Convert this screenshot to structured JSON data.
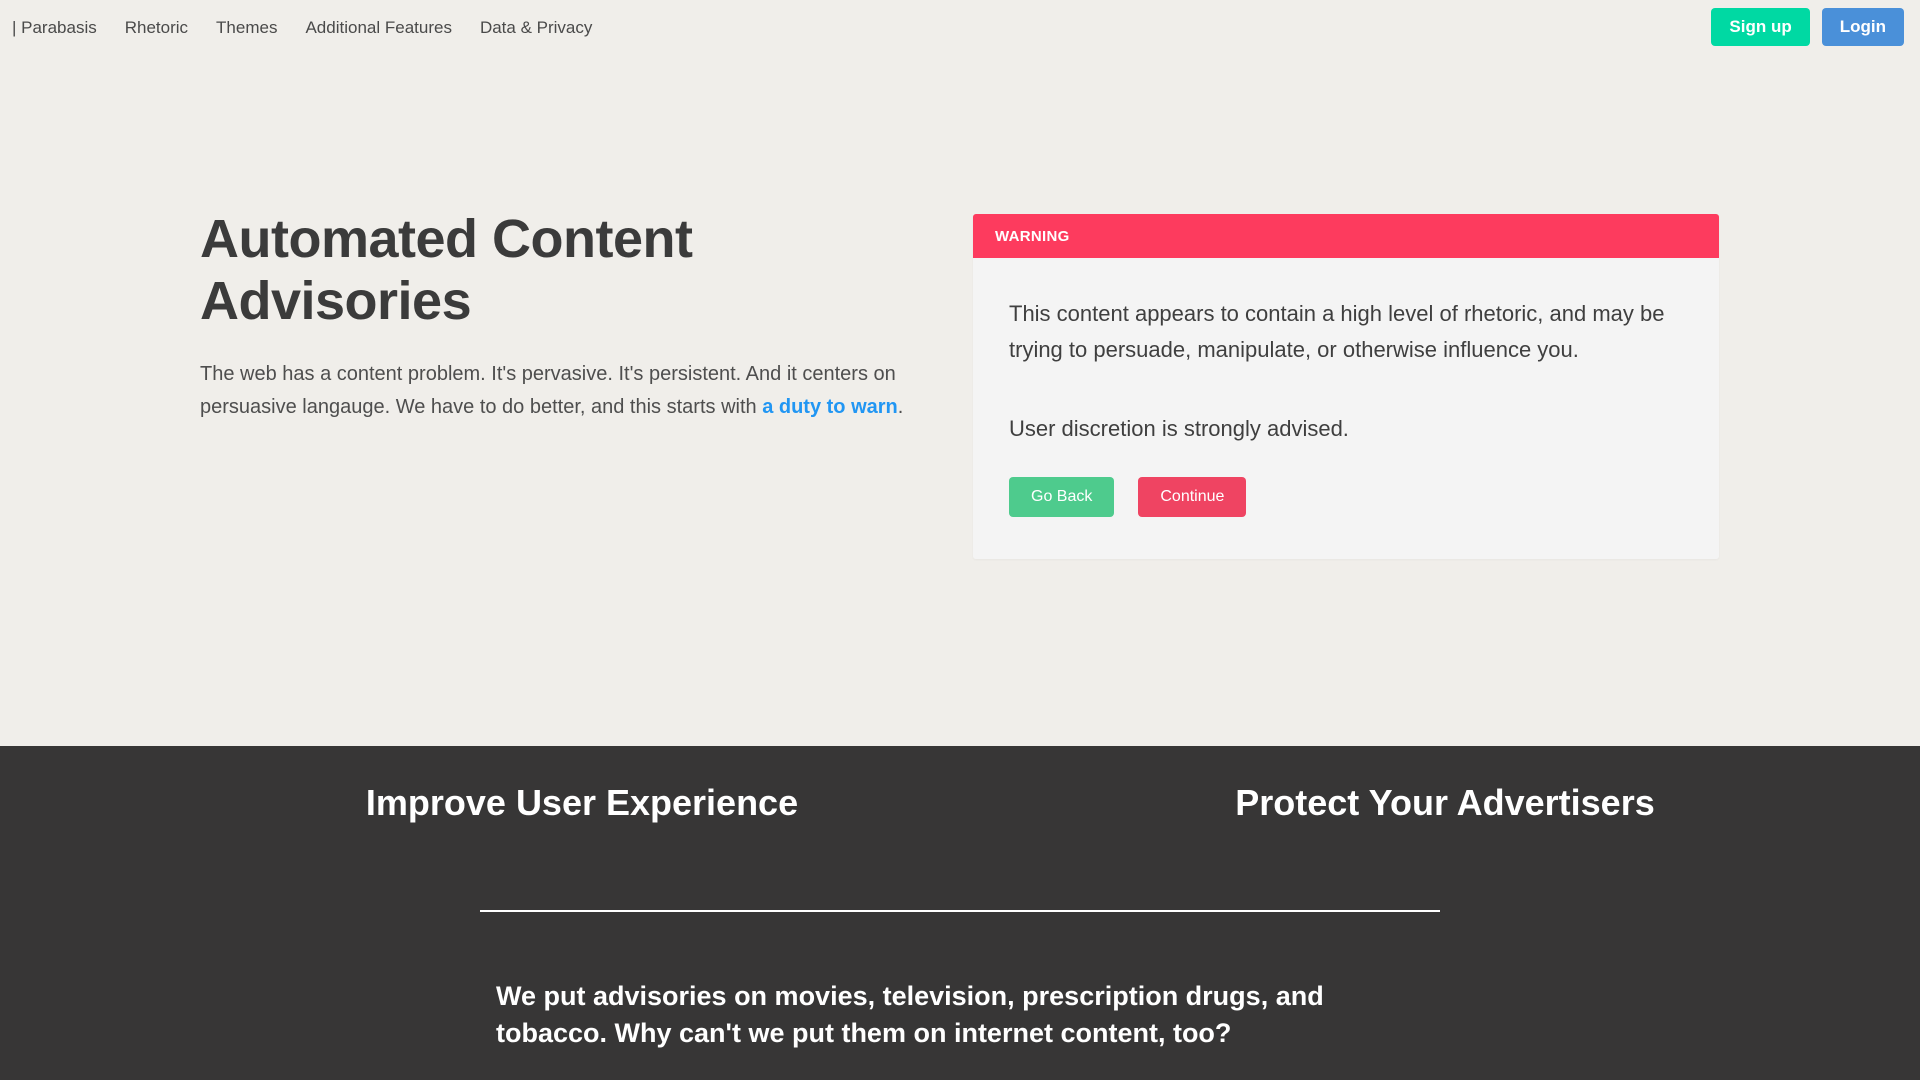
{
  "navbar": {
    "brand": "| Parabasis",
    "items": [
      {
        "label": "Rhetoric"
      },
      {
        "label": "Themes"
      },
      {
        "label": "Additional Features"
      },
      {
        "label": "Data & Privacy"
      }
    ],
    "signup_label": "Sign up",
    "login_label": "Login",
    "signup_color": "#00d9a3",
    "login_color": "#4a90d9"
  },
  "hero": {
    "title": "Automated Content Advisories",
    "paragraph_before": "The web has a content problem. It's pervasive. It's persistent. And it centers on persuasive langauge. We have to do better, and this starts with ",
    "link_label": "a duty to warn",
    "paragraph_after": ".",
    "link_color": "#2196f3"
  },
  "warning_card": {
    "header_label": "WARNING",
    "header_color": "#fd3b5e",
    "body_color": "#f4f4f4",
    "body_text": "This content appears to contain a high level of rhetoric, and may be trying to persuade, manipulate, or otherwise influence you.",
    "advisory_text": "User discretion is strongly advised.",
    "go_back_label": "Go Back",
    "go_back_color": "#4ecb8d",
    "continue_label": "Continue",
    "continue_color": "#ef4462"
  },
  "dark_section": {
    "background_color": "#373636",
    "heading_left": "Improve User Experience",
    "heading_right": "Protect Your Advertisers",
    "paragraph": "We put advisories on movies, television, prescription drugs, and tobacco. Why can't we put them on internet content, too?"
  }
}
